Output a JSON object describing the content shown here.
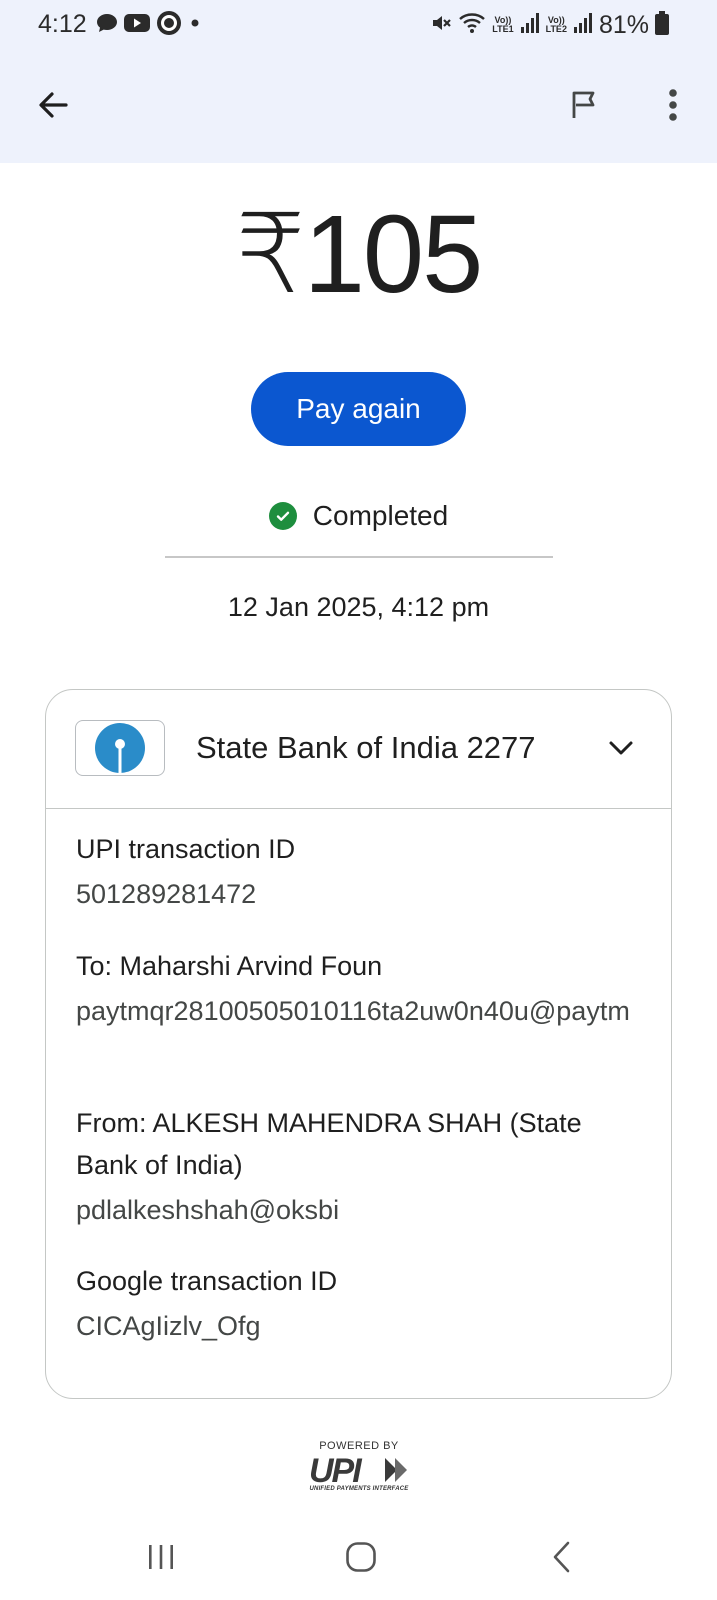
{
  "status_bar": {
    "time": "4:12",
    "battery": "81%",
    "sim1_label": "LTE1",
    "sim2_label": "LTE2",
    "volte_label": "Vo))"
  },
  "app_bar": {
    "back_icon": "arrow-back-icon",
    "flag_icon": "flag-icon",
    "more_icon": "more-vertical-icon"
  },
  "transaction": {
    "amount": "₹105",
    "pay_again_label": "Pay again",
    "status": "Completed",
    "datetime": "12 Jan 2025, 4:12 pm"
  },
  "card": {
    "bank_name": "State Bank of India 2277",
    "details": [
      {
        "label": "UPI transaction ID",
        "value": "501289281472"
      },
      {
        "label": "To: Maharshi Arvind Foun",
        "value": "paytmqr28100505010116ta2uw0n40u@paytm"
      },
      {
        "label": "From: ALKESH MAHENDRA SHAH (State Bank of India)",
        "value": "pdlalkeshshah@oksbi"
      },
      {
        "label": "Google transaction ID",
        "value": "CICAgIizlv_Ofg"
      }
    ]
  },
  "footer": {
    "powered_by": "POWERED BY",
    "upi_tagline": "UNIFIED PAYMENTS INTERFACE"
  },
  "colors": {
    "primary": "#0b57d0",
    "success": "#1e8e3e",
    "header_bg": "#eef2fc",
    "sbi_blue": "#2a8cc9"
  }
}
